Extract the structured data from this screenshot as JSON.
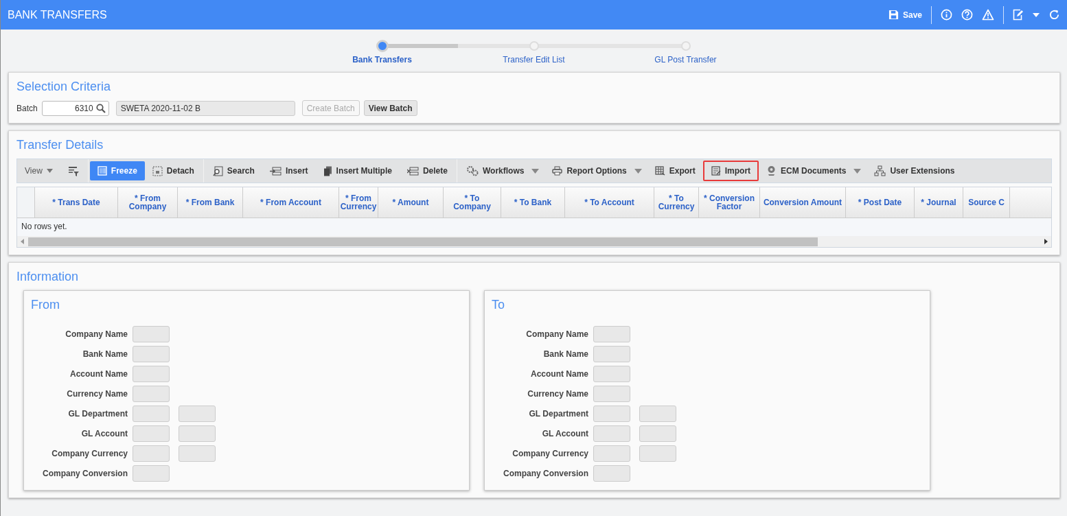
{
  "header": {
    "title": "BANK TRANSFERS",
    "save_label": "Save"
  },
  "steps": [
    {
      "label": "Bank Transfers",
      "selected": true
    },
    {
      "label": "Transfer Edit List",
      "selected": false
    },
    {
      "label": "GL Post Transfer",
      "selected": false
    }
  ],
  "selection_criteria": {
    "title": "Selection Criteria",
    "batch_label": "Batch",
    "batch_value": "6310",
    "batch_description": "SWETA 2020-11-02 B",
    "buttons": [
      {
        "label": "Create Batch",
        "disabled": true
      },
      {
        "label": "View Batch",
        "disabled": false
      }
    ]
  },
  "transfer_details": {
    "title": "Transfer Details",
    "toolbar": [
      {
        "kind": "view",
        "label": "View"
      },
      {
        "kind": "icon"
      },
      {
        "kind": "button",
        "label": "Freeze",
        "active": true,
        "highlighted": false,
        "has_menu": false
      },
      {
        "kind": "button",
        "label": "Detach",
        "active": false,
        "highlighted": false,
        "has_menu": false
      },
      {
        "kind": "button",
        "label": "Search",
        "active": false,
        "highlighted": false,
        "has_menu": false
      },
      {
        "kind": "button",
        "label": "Insert",
        "active": false,
        "highlighted": false,
        "has_menu": false
      },
      {
        "kind": "button",
        "label": "Insert Multiple",
        "active": false,
        "highlighted": false,
        "has_menu": false
      },
      {
        "kind": "button",
        "label": "Delete",
        "active": false,
        "highlighted": false,
        "has_menu": false
      },
      {
        "kind": "button",
        "label": "Workflows",
        "active": false,
        "highlighted": false,
        "has_menu": true
      },
      {
        "kind": "button",
        "label": "Report Options",
        "active": false,
        "highlighted": false,
        "has_menu": true
      },
      {
        "kind": "button",
        "label": "Export",
        "active": false,
        "highlighted": false,
        "has_menu": false
      },
      {
        "kind": "button",
        "label": "Import",
        "active": false,
        "highlighted": true,
        "has_menu": false
      },
      {
        "kind": "button",
        "label": "ECM Documents",
        "active": false,
        "highlighted": false,
        "has_menu": true
      },
      {
        "kind": "button",
        "label": "User Extensions",
        "active": false,
        "highlighted": false,
        "has_menu": false
      }
    ],
    "table": {
      "columns": [
        "* Trans Date",
        "* From Company",
        "* From Bank",
        "* From Account",
        "* From Currency",
        "* Amount",
        "* To Company",
        "* To Bank",
        "* To Account",
        "* To Currency",
        "* Conversion Factor",
        "Conversion Amount",
        "* Post Date",
        "* Journal",
        "Source C"
      ],
      "empty_message": "No rows yet."
    }
  },
  "information": {
    "title": "Information",
    "panels": [
      {
        "title": "From",
        "rows": [
          {
            "label": "Company Name",
            "kind": "single"
          },
          {
            "label": "Bank Name",
            "kind": "single"
          },
          {
            "label": "Account Name",
            "kind": "single"
          },
          {
            "label": "Currency Name",
            "kind": "single"
          },
          {
            "label": "GL Department",
            "kind": "pair"
          },
          {
            "label": "GL Account",
            "kind": "pair"
          },
          {
            "label": "Company Currency",
            "kind": "pair"
          },
          {
            "label": "Company Conversion",
            "kind": "single"
          }
        ]
      },
      {
        "title": "To",
        "rows": [
          {
            "label": "Company Name",
            "kind": "single"
          },
          {
            "label": "Bank Name",
            "kind": "single"
          },
          {
            "label": "Account Name",
            "kind": "single"
          },
          {
            "label": "Currency Name",
            "kind": "single"
          },
          {
            "label": "GL Department",
            "kind": "pair"
          },
          {
            "label": "GL Account",
            "kind": "pair"
          },
          {
            "label": "Company Currency",
            "kind": "pair"
          },
          {
            "label": "Company Conversion",
            "kind": "single"
          }
        ]
      }
    ]
  }
}
